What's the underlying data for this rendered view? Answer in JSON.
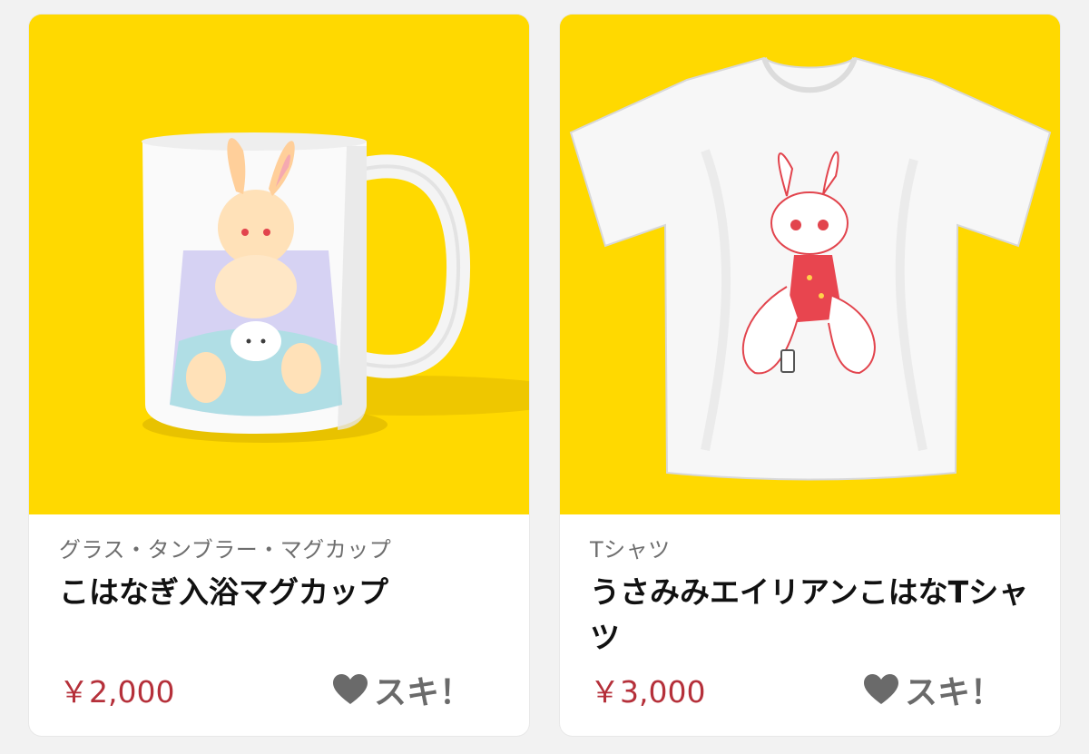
{
  "products": [
    {
      "category": "グラス・タンブラー・マグカップ",
      "title": "こはなぎ入浴マグカップ",
      "price": "￥2,000",
      "like_label": "スキ！",
      "thumbnail_bg": "#ffd900",
      "image_icon": "mug-illustration"
    },
    {
      "category": "Tシャツ",
      "title": "うさみみエイリアンこはなTシャツ",
      "price": "￥3,000",
      "like_label": "スキ！",
      "thumbnail_bg": "#ffd900",
      "image_icon": "tshirt-illustration"
    }
  ],
  "colors": {
    "price": "#b5303a",
    "like": "#6a6a6a",
    "category": "#6e6e6e"
  },
  "icons": {
    "like": "heart-icon"
  }
}
